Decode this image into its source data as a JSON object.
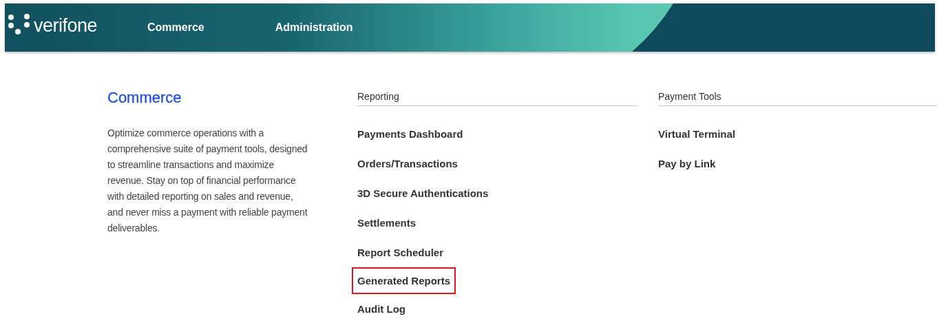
{
  "header": {
    "logo": "verifone",
    "nav": [
      {
        "label": "Commerce"
      },
      {
        "label": "Administration"
      }
    ]
  },
  "intro": {
    "title": "Commerce",
    "description": "Optimize commerce operations with a comprehensive suite of payment tools, designed to streamline transactions and maximize revenue. Stay on top of financial performance with detailed reporting on sales and revenue, and never miss a payment with reliable payment deliverables."
  },
  "sections": [
    {
      "heading": "Reporting",
      "links": [
        {
          "label": "Payments Dashboard",
          "highlighted": false
        },
        {
          "label": "Orders/Transactions",
          "highlighted": false
        },
        {
          "label": "3D Secure Authentications",
          "highlighted": false
        },
        {
          "label": "Settlements",
          "highlighted": false
        },
        {
          "label": "Report Scheduler",
          "highlighted": false
        },
        {
          "label": "Generated Reports",
          "highlighted": true
        },
        {
          "label": "Audit Log",
          "highlighted": false
        }
      ]
    },
    {
      "heading": "Payment Tools",
      "links": [
        {
          "label": "Virtual Terminal",
          "highlighted": false
        },
        {
          "label": "Pay by Link",
          "highlighted": false
        }
      ]
    }
  ]
}
